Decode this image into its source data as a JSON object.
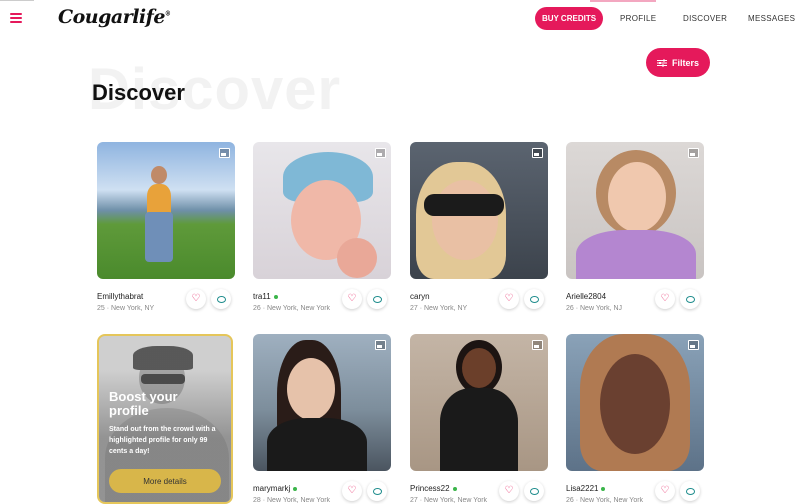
{
  "header": {
    "logo_text": "Cougarlife",
    "logo_mark": "®",
    "buy_credits": "BUY CREDITS",
    "nav": [
      "PROFILE",
      "DISCOVER",
      "MESSAGES"
    ]
  },
  "page": {
    "title": "Discover",
    "background_word": "Discover",
    "filters_label": "Filters"
  },
  "colors": {
    "accent": "#e5195b",
    "online": "#3bb54a",
    "message": "#1d8c8c",
    "boost_border": "#e5c65a"
  },
  "profiles": [
    {
      "name": "Emillythabrat",
      "meta": "25 · New York, NY",
      "online": false
    },
    {
      "name": "tra11",
      "meta": "26 · New York, New York",
      "online": true
    },
    {
      "name": "caryn",
      "meta": "27 · New York, NY",
      "online": false
    },
    {
      "name": "Arielle2804",
      "meta": "26 · New York, NJ",
      "online": false
    },
    {
      "name": "marymarkj",
      "meta": "28 · New York, New York",
      "online": true
    },
    {
      "name": "Princess22",
      "meta": "27 · New York, New York",
      "online": true
    },
    {
      "name": "Lisa2221",
      "meta": "26 · New York, New York",
      "online": true
    }
  ],
  "boost": {
    "title": "Boost your profile",
    "text": "Stand out from the crowd with a highlighted profile for only 99 cents a day!",
    "button": "More details"
  },
  "icons": {
    "menu": "hamburger-icon",
    "filters": "sliders-icon",
    "like": "heart-icon",
    "message": "chat-bubble-icon",
    "gallery": "gallery-icon"
  }
}
